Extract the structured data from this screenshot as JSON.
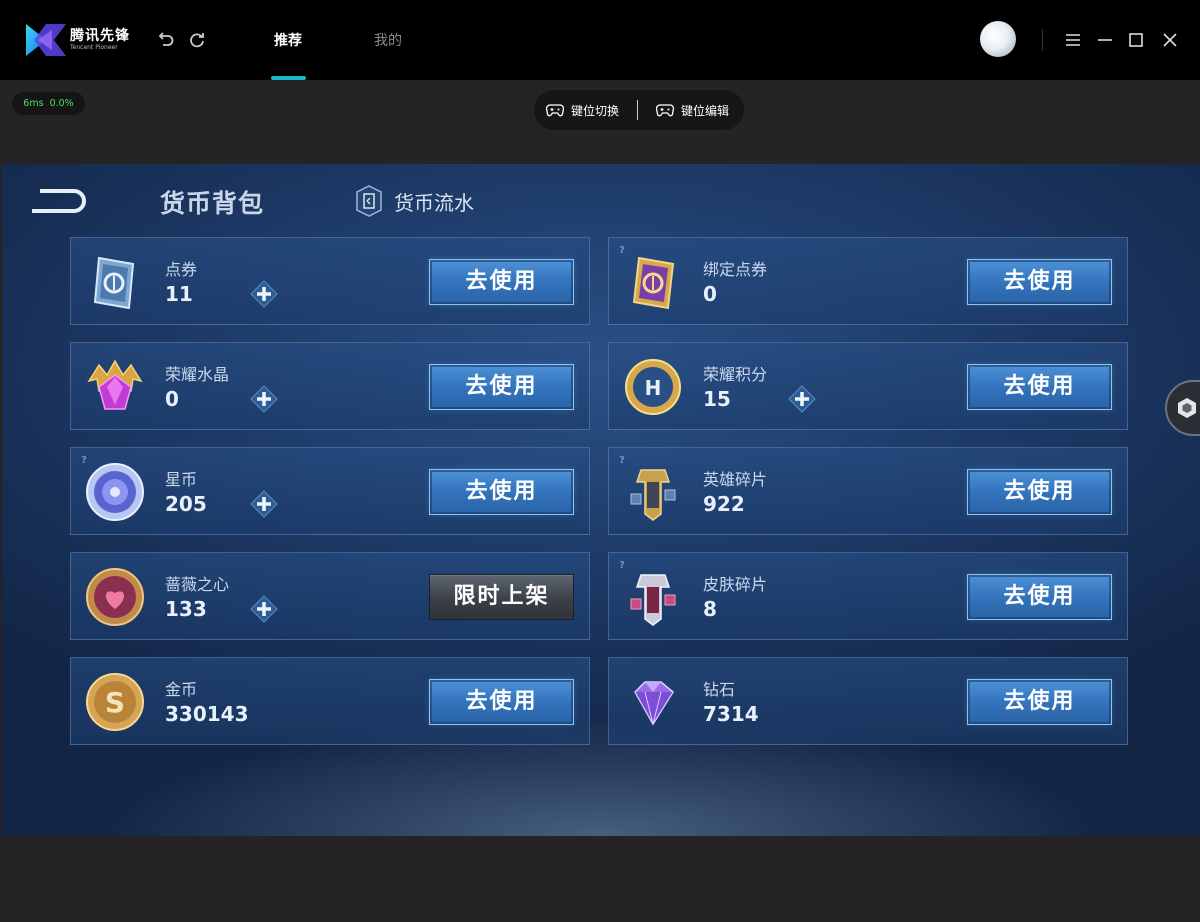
{
  "app": {
    "logo_text": "腾讯先锋",
    "logo_sub": "Tencent Pioneer",
    "tabs": [
      {
        "label": "推荐",
        "active": true
      },
      {
        "label": "我的",
        "active": false
      }
    ],
    "accent_color": "#16b9c9"
  },
  "status": {
    "latency": "6ms",
    "loss": "0.0%"
  },
  "keybar": {
    "switch_label": "键位切换",
    "edit_label": "键位编辑"
  },
  "game": {
    "title": "货币背包",
    "flow_label": "货币流水",
    "items": [
      {
        "name": "点券",
        "amount": "11",
        "action": "去使用",
        "icon": "coupon-icon",
        "has_plus": true,
        "has_help": false
      },
      {
        "name": "绑定点券",
        "amount": "0",
        "action": "去使用",
        "icon": "bound-coupon-icon",
        "has_plus": false,
        "has_help": true
      },
      {
        "name": "荣耀水晶",
        "amount": "0",
        "action": "去使用",
        "icon": "glory-crystal-icon",
        "has_plus": true,
        "has_help": false
      },
      {
        "name": "荣耀积分",
        "amount": "15",
        "action": "去使用",
        "icon": "glory-points-icon",
        "has_plus": true,
        "has_help": false
      },
      {
        "name": "星币",
        "amount": "205",
        "action": "去使用",
        "icon": "star-coin-icon",
        "has_plus": true,
        "has_help": true
      },
      {
        "name": "英雄碎片",
        "amount": "922",
        "action": "去使用",
        "icon": "hero-fragment-icon",
        "has_plus": false,
        "has_help": true
      },
      {
        "name": "蔷薇之心",
        "amount": "133",
        "action": "限时上架",
        "icon": "rose-heart-icon",
        "has_plus": true,
        "has_help": false
      },
      {
        "name": "皮肤碎片",
        "amount": "8",
        "action": "去使用",
        "icon": "skin-fragment-icon",
        "has_plus": false,
        "has_help": true
      },
      {
        "name": "金币",
        "amount": "330143",
        "action": "去使用",
        "icon": "gold-coin-icon",
        "has_plus": false,
        "has_help": false
      },
      {
        "name": "钻石",
        "amount": "7314",
        "action": "去使用",
        "icon": "diamond-icon",
        "has_plus": false,
        "has_help": false
      }
    ]
  }
}
